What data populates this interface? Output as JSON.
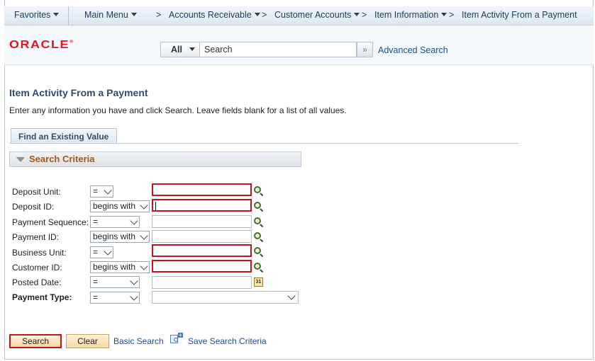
{
  "breadcrumb": {
    "favorites": "Favorites",
    "main_menu": "Main Menu",
    "accounts_receivable": "Accounts Receivable",
    "customer_accounts": "Customer Accounts",
    "item_information": "Item Information",
    "current": "Item Activity From a Payment",
    "separator": ">"
  },
  "header": {
    "logo": "ORACLE",
    "logo_mark": "®",
    "search_scope": "All",
    "search_placeholder": "Search",
    "go_glyph": "»",
    "advanced_search": "Advanced Search"
  },
  "page": {
    "title": "Item Activity From a Payment",
    "instructions": "Enter any information you have and click Search. Leave fields blank for a list of all values."
  },
  "tabs": {
    "find_existing": "Find an Existing Value"
  },
  "search_criteria": {
    "title": "Search Criteria",
    "fields": [
      {
        "label": "Deposit Unit:",
        "operator": "=",
        "value": "",
        "required": true
      },
      {
        "label": "Deposit ID:",
        "operator": "begins with",
        "value": "",
        "required": true
      },
      {
        "label": "Payment Sequence:",
        "operator": "=",
        "value": "",
        "required": false
      },
      {
        "label": "Payment ID:",
        "operator": "begins with",
        "value": "",
        "required": false
      },
      {
        "label": "Business Unit:",
        "operator": "=",
        "value": "",
        "required": true
      },
      {
        "label": "Customer ID:",
        "operator": "begins with",
        "value": "",
        "required": true
      },
      {
        "label": "Posted Date:",
        "operator": "=",
        "value": "",
        "required": false
      },
      {
        "label": "Payment Type:",
        "operator": "=",
        "value": "",
        "required": false
      }
    ],
    "calendar_glyph": "31"
  },
  "actions": {
    "search": "Search",
    "clear": "Clear",
    "basic_search": "Basic Search",
    "save_search_criteria": "Save Search Criteria",
    "save_plus": "+"
  },
  "colors": {
    "required_border": "#c8141c",
    "link": "#1a4f8a",
    "title": "#2c4b74",
    "section_title": "#a3591e",
    "oracle_red": "#e0161d"
  }
}
